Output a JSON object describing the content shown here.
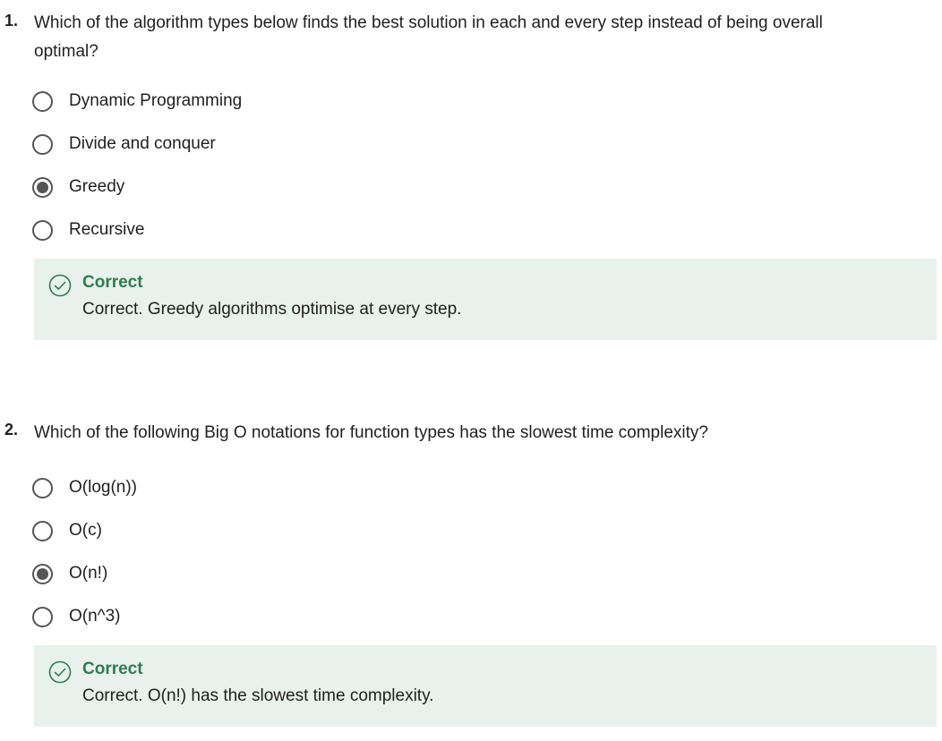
{
  "questions": [
    {
      "number": "1.",
      "text": "Which of the algorithm types below finds the best solution in each and every step instead of being overall optimal?",
      "options": [
        {
          "label": "Dynamic Programming",
          "selected": false
        },
        {
          "label": "Divide and conquer",
          "selected": false
        },
        {
          "label": "Greedy",
          "selected": true
        },
        {
          "label": "Recursive",
          "selected": false
        }
      ],
      "feedback": {
        "title": "Correct",
        "text": "Correct. Greedy algorithms optimise at every step."
      }
    },
    {
      "number": "2.",
      "text": "Which of the following Big O notations for function types has the slowest time complexity?",
      "options": [
        {
          "label": "O(log(n))",
          "selected": false
        },
        {
          "label": "O(c)",
          "selected": false
        },
        {
          "label": "O(n!)",
          "selected": true
        },
        {
          "label": "O(n^3)",
          "selected": false
        }
      ],
      "feedback": {
        "title": "Correct",
        "text": "Correct. O(n!) has the slowest time complexity."
      }
    }
  ],
  "colors": {
    "feedback_bg": "#e8f1ec",
    "correct_green": "#2e7d4f",
    "radio_gray": "#555555"
  },
  "icons": {
    "feedback": "check-circle-icon",
    "option": "radio-button-icon"
  }
}
